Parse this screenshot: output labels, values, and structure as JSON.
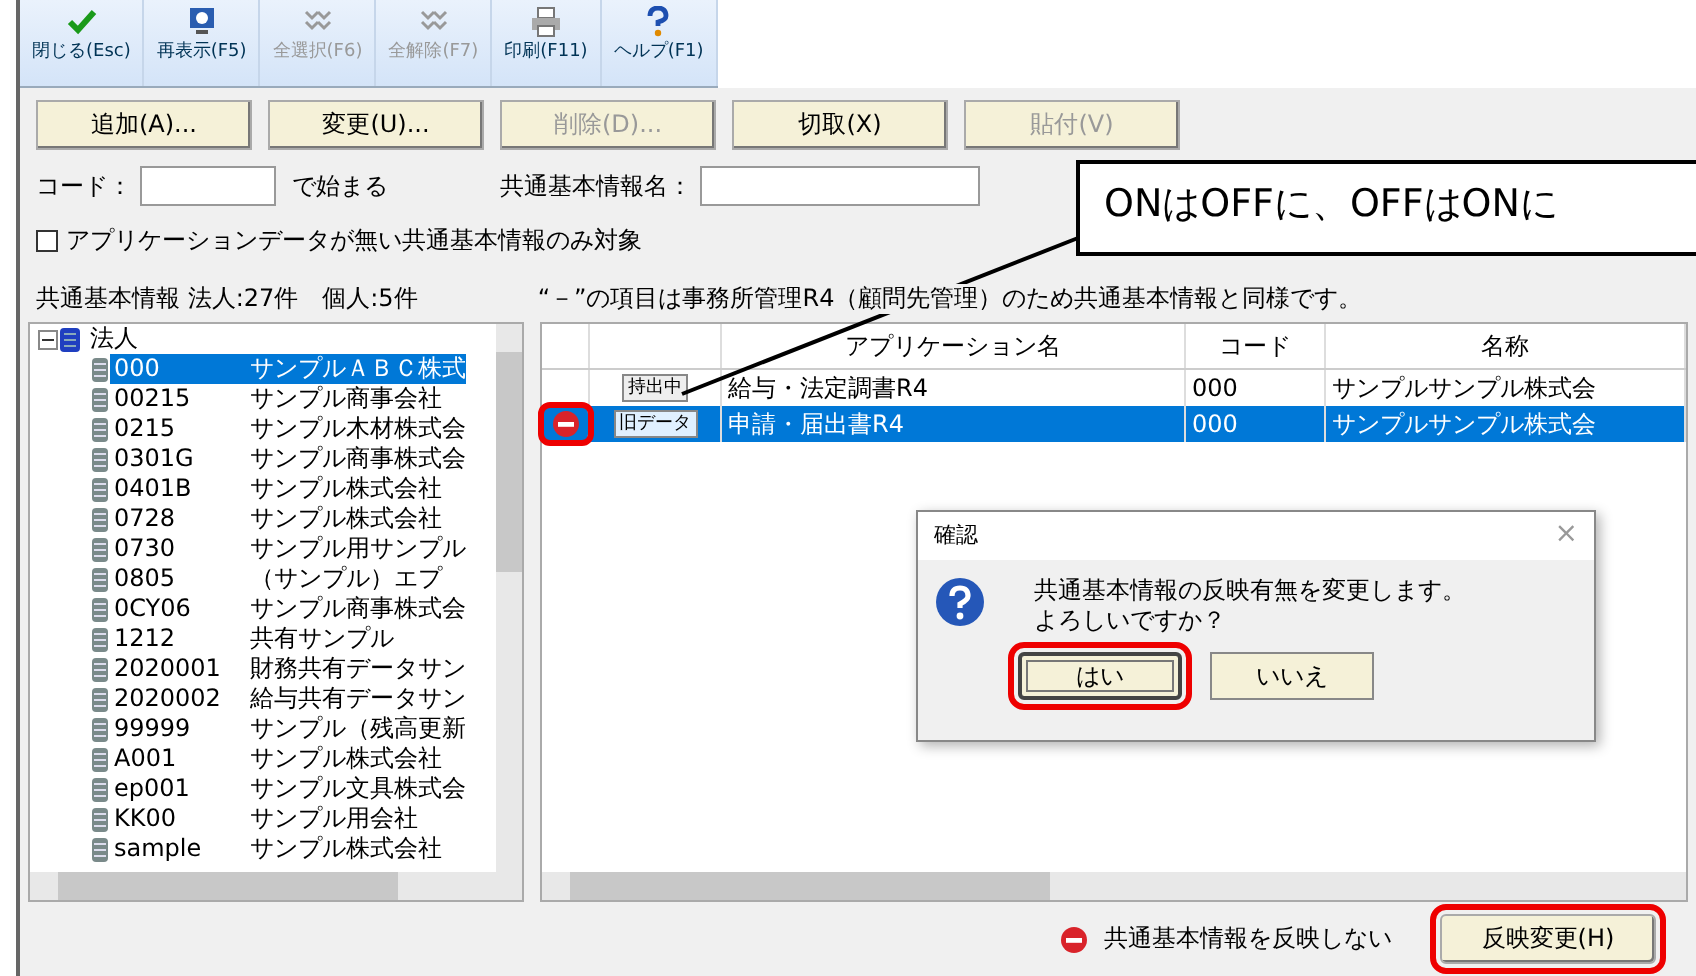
{
  "toolbar": [
    {
      "label": "閉じる(Esc)",
      "disabled": false
    },
    {
      "label": "再表示(F5)",
      "disabled": false
    },
    {
      "label": "全選択(F6)",
      "disabled": true
    },
    {
      "label": "全解除(F7)",
      "disabled": true
    },
    {
      "label": "印刷(F11)",
      "disabled": false
    },
    {
      "label": "ヘルプ(F1)",
      "disabled": false
    }
  ],
  "action_buttons": [
    {
      "label": "追加(A)...",
      "disabled": false
    },
    {
      "label": "変更(U)...",
      "disabled": false
    },
    {
      "label": "削除(D)...",
      "disabled": true
    },
    {
      "label": "切取(X)",
      "disabled": false
    },
    {
      "label": "貼付(V)",
      "disabled": true
    }
  ],
  "filter": {
    "code_label": "コード：",
    "code_suffix": "で始まる",
    "name_label": "共通基本情報名："
  },
  "only_empty_option": {
    "label": "アプリケーションデータが無い共通基本情報のみ対象",
    "checked": false
  },
  "summary": "共通基本情報 法人:27件　個人:5件",
  "note": "“－”の項目は事務所管理R4（顧問先管理）のため共通基本情報と同様です。",
  "tree": {
    "label": "法人",
    "expanded": true,
    "children": [
      {
        "code": "000",
        "name": "サンプルＡＢＣ株式",
        "selected": true
      },
      {
        "code": "00215",
        "name": "サンプル商事会社",
        "selected": false
      },
      {
        "code": "0215",
        "name": "サンプル木材株式会",
        "selected": false
      },
      {
        "code": "0301G",
        "name": "サンプル商事株式会",
        "selected": false
      },
      {
        "code": "0401B",
        "name": "サンプル株式会社",
        "selected": false
      },
      {
        "code": "0728",
        "name": "サンプル株式会社",
        "selected": false
      },
      {
        "code": "0730",
        "name": "サンプル用サンプル",
        "selected": false
      },
      {
        "code": "0805",
        "name": "（サンプル）エプ",
        "selected": false
      },
      {
        "code": "0CY06",
        "name": "サンプル商事株式会",
        "selected": false
      },
      {
        "code": "1212",
        "name": "共有サンプル",
        "selected": false
      },
      {
        "code": "2020001",
        "name": "財務共有データサン",
        "selected": false
      },
      {
        "code": "2020002",
        "name": "給与共有データサン",
        "selected": false
      },
      {
        "code": "99999",
        "name": "サンプル（残高更新",
        "selected": false
      },
      {
        "code": "A001",
        "name": "サンプル株式会社",
        "selected": false
      },
      {
        "code": "ep001",
        "name": "サンプル文具株式会",
        "selected": false
      },
      {
        "code": "KK00",
        "name": "サンプル用会社",
        "selected": false
      },
      {
        "code": "sample",
        "name": "サンプル株式会社",
        "selected": false
      }
    ]
  },
  "grid": {
    "columns": [
      "アプリケーション名",
      "コード",
      "名称"
    ],
    "rows": [
      {
        "not_reflected": false,
        "highlighted": false,
        "badge": "持出中",
        "app": "給与・法定調書R4",
        "code": "000",
        "name": "サンプルサンプル株式会",
        "selected": false
      },
      {
        "not_reflected": true,
        "highlighted": true,
        "badge": "旧データ",
        "app": "申請・届出書R4",
        "code": "000",
        "name": "サンプルサンプル株式会",
        "selected": true
      }
    ]
  },
  "callout": {
    "text": "ONはOFFに、OFFはONに"
  },
  "dialog": {
    "title": "確認",
    "close": "×",
    "message": [
      "共通基本情報の反映有無を変更します。",
      "よろしいですか？"
    ],
    "buttons": [
      {
        "label": "はい",
        "focused": true,
        "highlighted": true
      },
      {
        "label": "いいえ",
        "focused": false,
        "highlighted": false
      }
    ]
  },
  "legend": {
    "text": "共通基本情報を反映しない"
  },
  "apply_button": {
    "label": "反映変更(H)",
    "highlighted": true
  }
}
